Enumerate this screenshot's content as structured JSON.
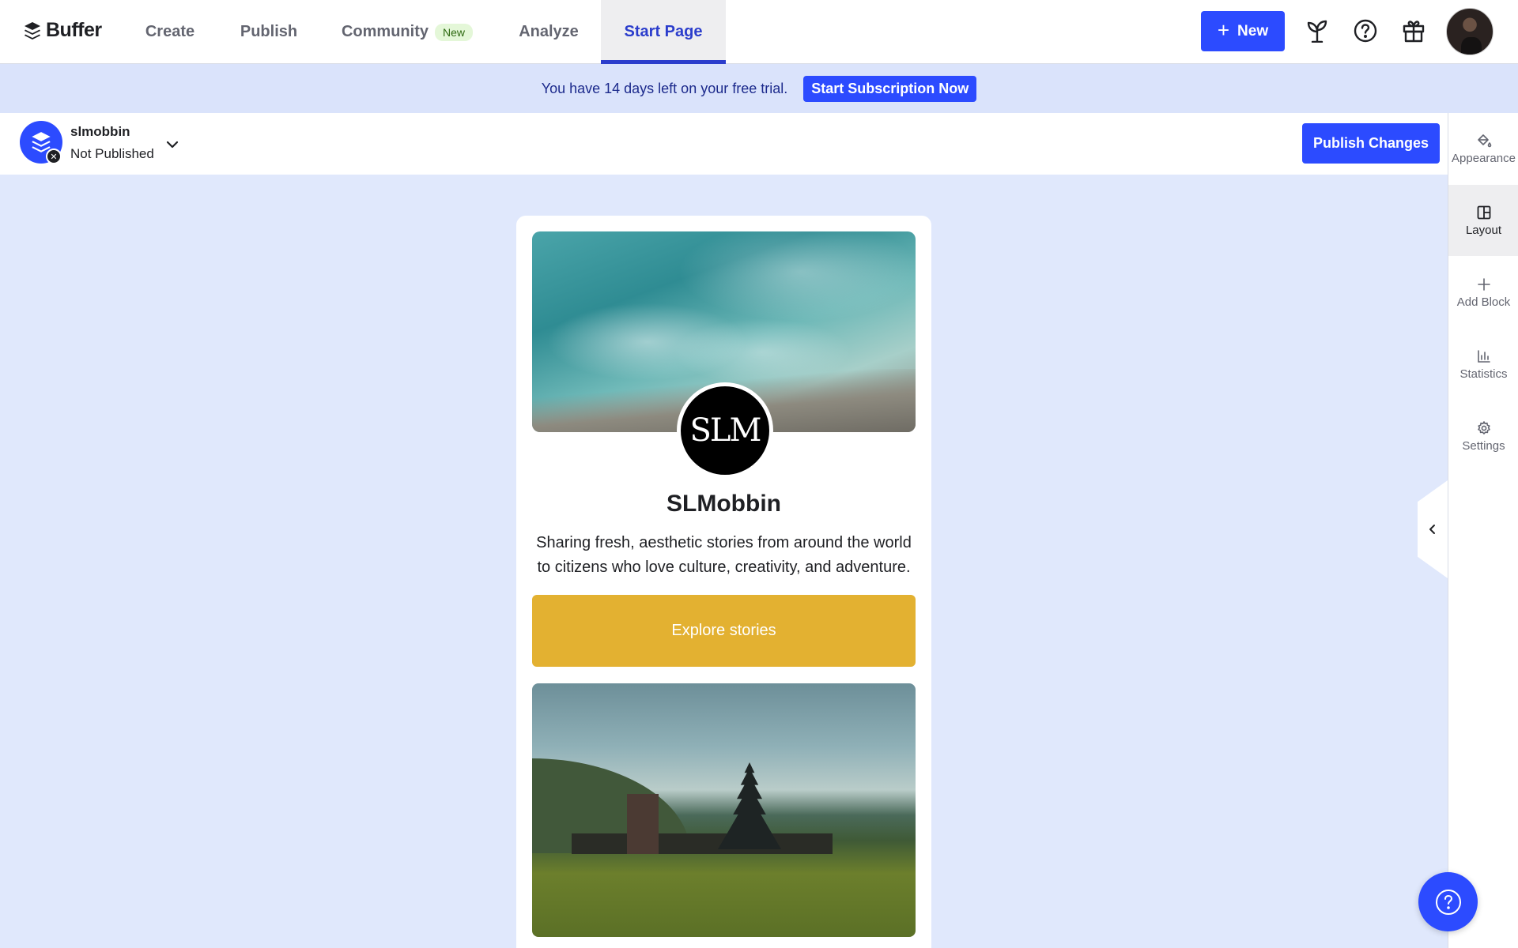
{
  "app": {
    "logo_text": "Buffer"
  },
  "nav": {
    "tabs": [
      {
        "label": "Create"
      },
      {
        "label": "Publish"
      },
      {
        "label": "Community",
        "badge": "New"
      },
      {
        "label": "Analyze"
      },
      {
        "label": "Start Page",
        "active": true
      }
    ],
    "new_button": "New",
    "icons": [
      "sprout-icon",
      "help-circle-icon",
      "gift-icon",
      "avatar"
    ]
  },
  "trial_banner": {
    "text": "You have 14 days left on your free trial.",
    "button": "Start Subscription Now"
  },
  "page_header": {
    "page_name": "slmobbin",
    "status": "Not Published",
    "publish_button": "Publish Changes"
  },
  "sidebar": {
    "items": [
      {
        "label": "Appearance",
        "icon": "paint-bucket-icon"
      },
      {
        "label": "Layout",
        "icon": "layout-icon",
        "active": true
      },
      {
        "label": "Add Block",
        "icon": "plus-icon"
      },
      {
        "label": "Statistics",
        "icon": "bar-chart-icon"
      },
      {
        "label": "Settings",
        "icon": "gear-icon"
      }
    ]
  },
  "preview": {
    "logo_text": "SLM",
    "name": "SLMobbin",
    "bio": "Sharing fresh, aesthetic stories from around the world to citizens who love culture, creativity, and adventure.",
    "cta_label": "Explore stories",
    "cta_color": "#E3B131"
  },
  "colors": {
    "accent": "#2C4BFF",
    "background": "#E0E8FC"
  }
}
